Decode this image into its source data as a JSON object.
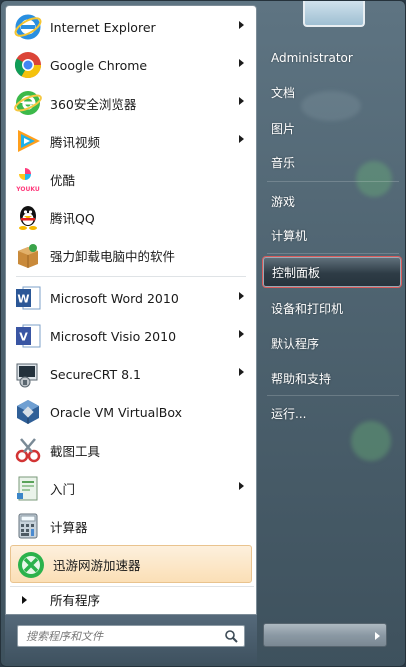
{
  "programs": [
    {
      "label": "Internet Explorer",
      "icon": "ie-icon",
      "has_arrow": true
    },
    {
      "label": "Google Chrome",
      "icon": "chrome-icon",
      "has_arrow": true
    },
    {
      "label": "360安全浏览器",
      "icon": "360-browser-icon",
      "has_arrow": true
    },
    {
      "label": "腾讯视频",
      "icon": "tencent-video-icon",
      "has_arrow": true
    },
    {
      "label": "优酷",
      "icon": "youku-icon",
      "has_arrow": false
    },
    {
      "label": "腾讯QQ",
      "icon": "qq-penguin-icon",
      "has_arrow": false
    },
    {
      "label": "强力卸载电脑中的软件",
      "icon": "uninstall-box-icon",
      "has_arrow": false
    },
    {
      "label": "Microsoft Word 2010",
      "icon": "word-icon",
      "has_arrow": true
    },
    {
      "label": "Microsoft Visio 2010",
      "icon": "visio-icon",
      "has_arrow": true
    },
    {
      "label": "SecureCRT 8.1",
      "icon": "securecrt-icon",
      "has_arrow": true
    },
    {
      "label": "Oracle VM VirtualBox",
      "icon": "virtualbox-icon",
      "has_arrow": false
    },
    {
      "label": "截图工具",
      "icon": "snipping-tool-icon",
      "has_arrow": false
    },
    {
      "label": "入门",
      "icon": "getting-started-icon",
      "has_arrow": true
    },
    {
      "label": "计算器",
      "icon": "calculator-icon",
      "has_arrow": false
    },
    {
      "label": "迅游网游加速器",
      "icon": "xunyou-icon",
      "has_arrow": false
    }
  ],
  "all_programs": "所有程序",
  "search": {
    "placeholder": "搜索程序和文件"
  },
  "right": {
    "user": "Administrator",
    "items": [
      "文档",
      "图片",
      "音乐",
      "游戏",
      "计算机",
      "控制面板",
      "设备和打印机",
      "默认程序",
      "帮助和支持",
      "运行..."
    ]
  },
  "colors": {
    "highlight": "#fbdfb6",
    "active_outline": "#d85a5a"
  }
}
